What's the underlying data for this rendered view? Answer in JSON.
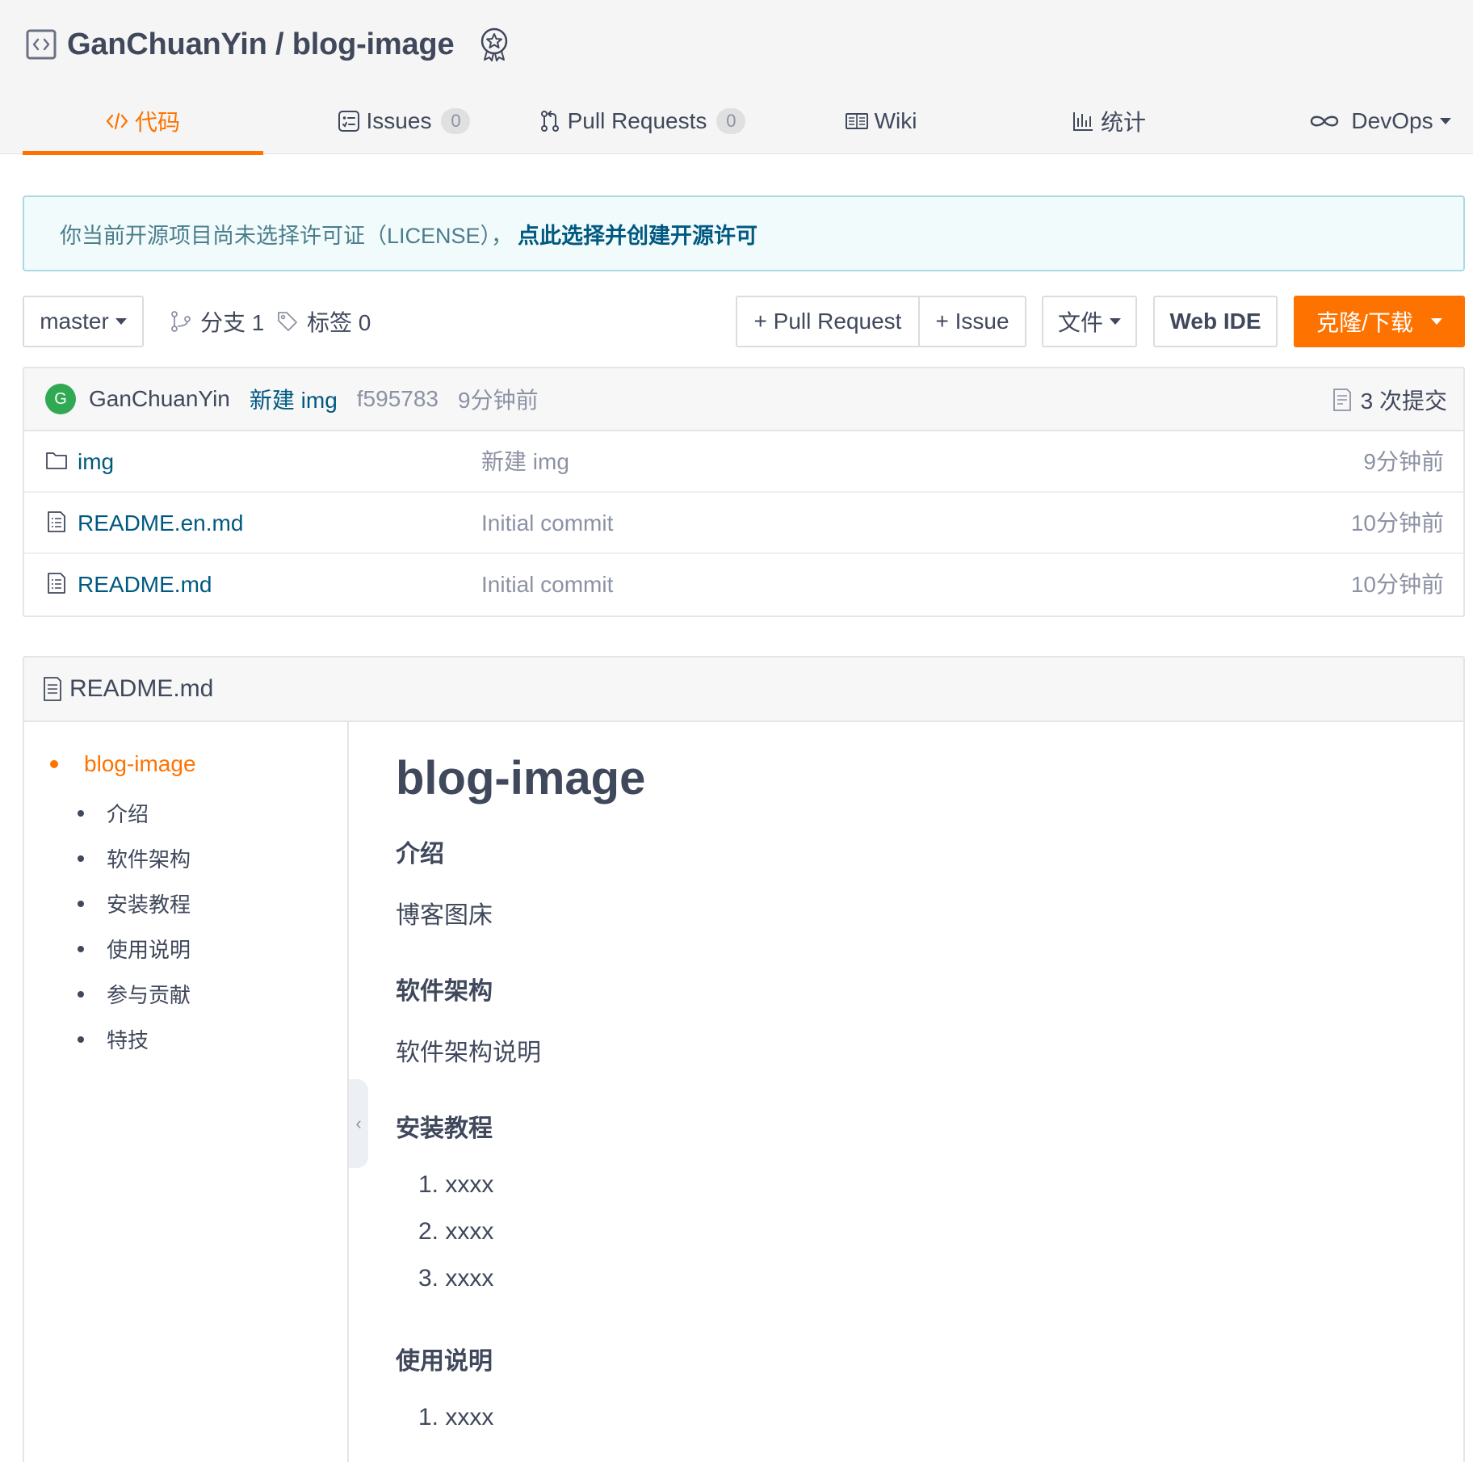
{
  "repo": {
    "owner": "GanChuanYin",
    "separator": " / ",
    "name": "blog-image",
    "icon": "repo-icon",
    "badge_icon": "award-badge-icon"
  },
  "tabs": [
    {
      "label": "代码",
      "icon": "code-icon",
      "active": true
    },
    {
      "label": "Issues",
      "icon": "issues-icon",
      "count": "0"
    },
    {
      "label": "Pull Requests",
      "icon": "pull-request-icon",
      "count": "0"
    },
    {
      "label": "Wiki",
      "icon": "wiki-icon"
    },
    {
      "label": "统计",
      "icon": "stats-icon"
    },
    {
      "label": "DevOps",
      "icon": "infinity-icon"
    }
  ],
  "banner": {
    "text": "你当前开源项目尚未选择许可证（LICENSE），",
    "link": "点此选择并创建开源许可"
  },
  "toolbar": {
    "branch": "master",
    "branches": "分支 1",
    "tags": "标签 0",
    "pull_request": "+ Pull Request",
    "issue": "+ Issue",
    "file": "文件",
    "web_ide": "Web IDE",
    "clone": "克隆/下载"
  },
  "commit": {
    "avatar_letter": "G",
    "author": "GanChuanYin",
    "message": "新建 img",
    "hash": "f595783",
    "time": "9分钟前",
    "count": "3 次提交"
  },
  "files": [
    {
      "name": "img",
      "type": "folder",
      "commit": "新建 img",
      "time": "9分钟前"
    },
    {
      "name": "README.en.md",
      "type": "file",
      "commit": "Initial commit",
      "time": "10分钟前"
    },
    {
      "name": "README.md",
      "type": "file",
      "commit": "Initial commit",
      "time": "10分钟前"
    }
  ],
  "readme": {
    "filename": "README.md",
    "toc": {
      "top": "blog-image",
      "items": [
        "介绍",
        "软件架构",
        "安装教程",
        "使用说明",
        "参与贡献",
        "特技"
      ]
    },
    "h1": "blog-image",
    "sections": {
      "intro_h": "介绍",
      "intro_p": "博客图床",
      "arch_h": "软件架构",
      "arch_p": "软件架构说明",
      "install_h": "安装教程",
      "install_items": [
        "1. xxxx",
        "2. xxxx",
        "3. xxxx"
      ],
      "usage_h": "使用说明",
      "usage_items": [
        "1. xxxx"
      ]
    }
  },
  "colors": {
    "accent": "#fe7300",
    "link": "#005980",
    "avatar": "#2fa952",
    "banner_bg": "#f2fbfc",
    "banner_border": "#a9dae3"
  }
}
